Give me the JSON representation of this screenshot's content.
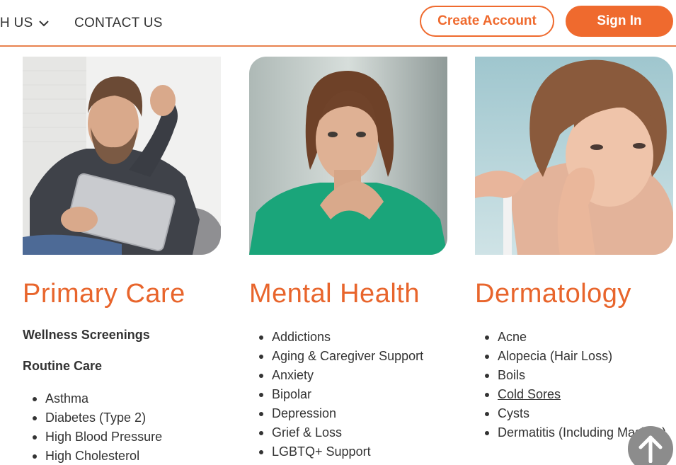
{
  "nav": {
    "about_label": "TH US",
    "contact_label": "CONTACT US"
  },
  "auth": {
    "create_account_label": "Create Account",
    "sign_in_label": "Sign In"
  },
  "colors": {
    "brand_orange": "#ef6a2e",
    "title_orange": "#e8652c",
    "text": "#333333",
    "scroll_button": "#8c8c8c"
  },
  "cards": [
    {
      "title": "Primary Care",
      "subheadings": [
        "Wellness Screenings",
        "Routine Care"
      ],
      "items": [
        "Asthma",
        "Diabetes (Type 2)",
        "High Blood Pressure",
        "High Cholesterol"
      ]
    },
    {
      "title": "Mental Health",
      "subheadings": [],
      "items": [
        "Addictions",
        "Aging & Caregiver Support",
        "Anxiety",
        "Bipolar",
        "Depression",
        "Grief & Loss",
        "LGBTQ+ Support"
      ]
    },
    {
      "title": "Dermatology",
      "subheadings": [],
      "items": [
        "Acne",
        "Alopecia (Hair Loss)",
        "Boils",
        "Cold Sores",
        "Cysts",
        "Dermatitis (Including Maskne)"
      ]
    }
  ],
  "icons": {
    "about_chevron": "chevron-down-icon",
    "scroll_top": "arrow-up-icon"
  }
}
